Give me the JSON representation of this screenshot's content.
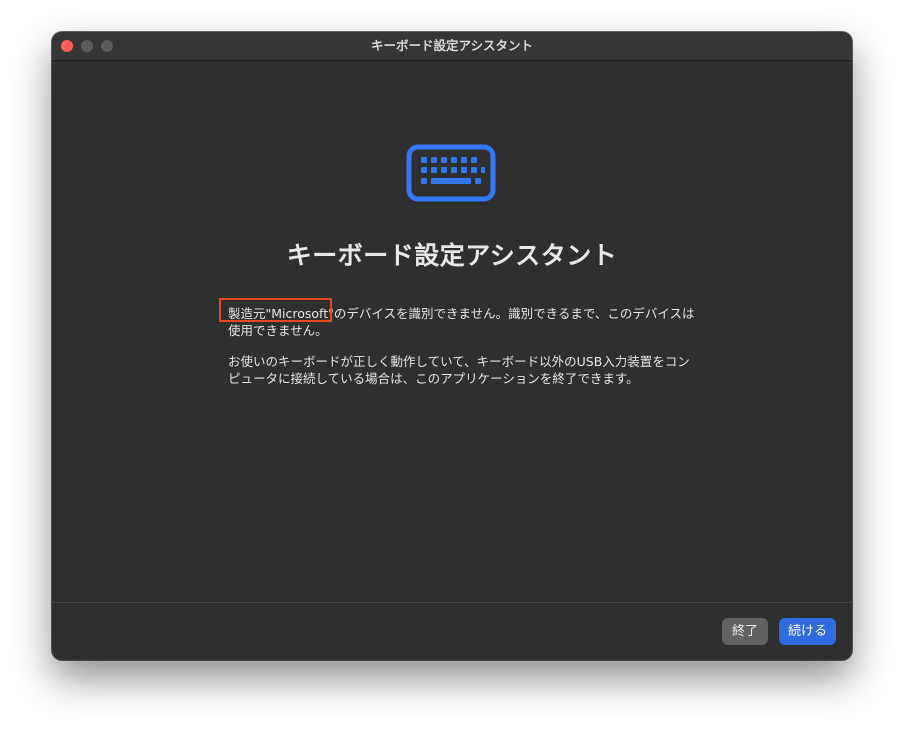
{
  "window": {
    "title": "キーボード設定アシスタント"
  },
  "icon": {
    "name": "keyboard-icon",
    "color": "#3478f6"
  },
  "main": {
    "heading": "キーボード設定アシスタント",
    "paragraph1_prefix": "製造元\"Microsoft\"",
    "paragraph1_rest": "のデバイスを識別できません。識別できるまで、このデバイスは使用できません。",
    "paragraph2": "お使いのキーボードが正しく動作していて、キーボード以外のUSB入力装置をコンピュータに接続している場合は、このアプリケーションを終了できます。"
  },
  "footer": {
    "quit_label": "終了",
    "continue_label": "続ける"
  },
  "colors": {
    "window_bg": "#2f2f2f",
    "accent": "#2f6be0",
    "highlight": "#e04c1f",
    "close_button": "#fe5f57"
  }
}
